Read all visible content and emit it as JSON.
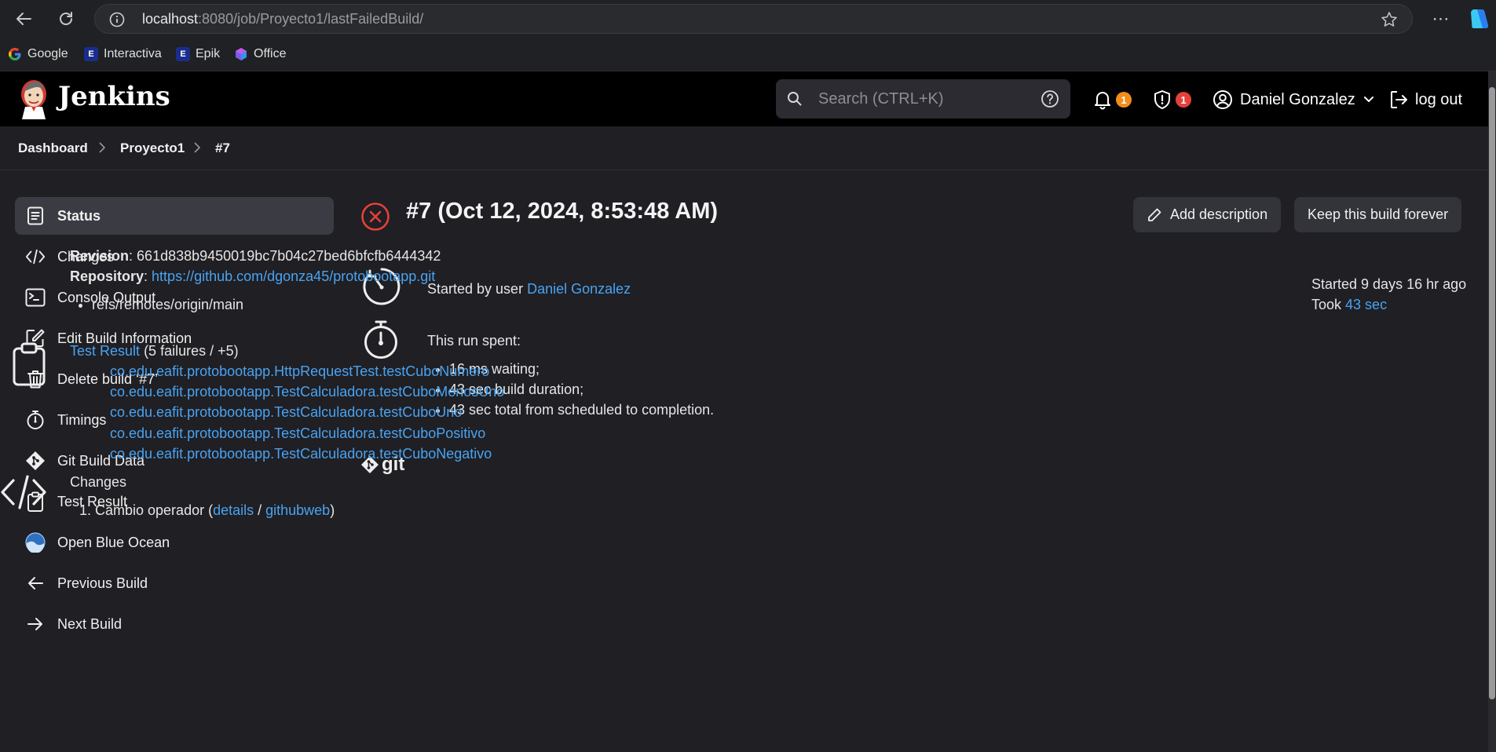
{
  "browser": {
    "url_host": "localhost",
    "url_path": ":8080/job/Proyecto1/lastFailedBuild/",
    "bookmarks": [
      {
        "label": "Google",
        "icon": "google-icon"
      },
      {
        "label": "Interactiva",
        "icon": "e-icon"
      },
      {
        "label": "Epik",
        "icon": "e-icon"
      },
      {
        "label": "Office",
        "icon": "office-icon"
      }
    ]
  },
  "header": {
    "title": "Jenkins",
    "search_placeholder": "Search (CTRL+K)",
    "notifications_count": "1",
    "security_count": "1",
    "user_name": "Daniel Gonzalez",
    "logout_label": "log out"
  },
  "breadcrumbs": [
    "Dashboard",
    "Proyecto1",
    "#7"
  ],
  "sidebar": {
    "items": [
      {
        "label": "Status",
        "icon": "status-icon",
        "active": true
      },
      {
        "label": "Changes",
        "icon": "code-icon"
      },
      {
        "label": "Console Output",
        "icon": "terminal-icon"
      },
      {
        "label": "Edit Build Information",
        "icon": "edit-icon"
      },
      {
        "label": "Delete build ‘#7’",
        "icon": "trash-icon"
      },
      {
        "label": "Timings",
        "icon": "stopwatch-icon"
      },
      {
        "label": "Git Build Data",
        "icon": "git-icon"
      },
      {
        "label": "Test Result",
        "icon": "clipboard-icon"
      },
      {
        "label": "Open Blue Ocean",
        "icon": "blue-ocean-icon"
      },
      {
        "label": "Previous Build",
        "icon": "arrow-left-icon"
      },
      {
        "label": "Next Build",
        "icon": "arrow-right-icon"
      }
    ]
  },
  "build": {
    "title": "#7 (Oct 12, 2024, 8:53:48 AM)",
    "add_description_label": "Add description",
    "keep_forever_label": "Keep this build forever",
    "started_prefix": "Started by user ",
    "started_user": "Daniel Gonzalez",
    "started_ago": "Started 9 days 16 hr ago",
    "took_prefix": "Took ",
    "took_value": "43 sec",
    "run_spent_label": "This run spent:",
    "run_spent_items": [
      "16 ms waiting;",
      "43 sec build duration;",
      "43 sec total from scheduled to completion."
    ],
    "git": {
      "logo_text": "git",
      "revision_label": "Revision",
      "revision": "661d838b9450019bc7b04c27bed6bfcfb6444342",
      "repository_label": "Repository",
      "repository": "https://github.com/dgonza45/protobootapp.git",
      "branches": [
        "refs/remotes/origin/main"
      ]
    },
    "tests": {
      "link_label": "Test Result",
      "summary": "(5 failures / +5)",
      "failures": [
        "co.edu.eafit.protobootapp.HttpRequestTest.testCuboNumero",
        "co.edu.eafit.protobootapp.TestCalculadora.testCuboMenosUno",
        "co.edu.eafit.protobootapp.TestCalculadora.testCuboUno",
        "co.edu.eafit.protobootapp.TestCalculadora.testCuboPositivo",
        "co.edu.eafit.protobootapp.TestCalculadora.testCuboNegativo"
      ]
    },
    "changes": {
      "label": "Changes",
      "items": [
        {
          "text": "Cambio operador",
          "details_label": "details",
          "web_label": "githubweb"
        }
      ]
    }
  },
  "colors": {
    "background": "#1f1f24",
    "header": "#000000",
    "link": "#4aa3f0",
    "fail": "#e5403b",
    "warning_badge": "#f28c1a",
    "security_badge": "#e5403b"
  }
}
